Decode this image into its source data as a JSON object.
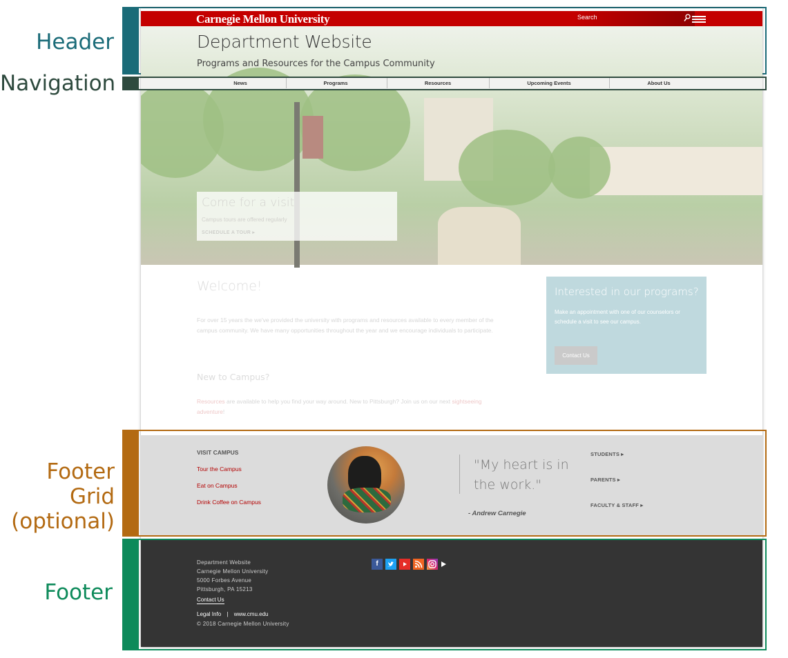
{
  "annotations": {
    "header": "Header",
    "navigation": "Navigation",
    "footer_grid": [
      "Footer Grid",
      "(optional)"
    ],
    "footer": "Footer"
  },
  "colors": {
    "header_annotation": "#1a6b78",
    "navigation_annotation": "#2e4a3e",
    "footer_grid_annotation": "#b36a12",
    "footer_annotation": "#0d8a5a",
    "brand_red": "#c40000"
  },
  "header": {
    "brand": "Carnegie Mellon University",
    "search_label": "Search",
    "search_icon": "search-icon",
    "menu_icon": "hamburger-menu-icon",
    "title": "Department Website",
    "subtitle": "Programs and Resources for the Campus Community"
  },
  "nav": {
    "items": [
      "News",
      "Programs",
      "Resources",
      "Upcoming Events",
      "About Us"
    ]
  },
  "hero": {
    "heading": "Come for a visit",
    "text": "Campus tours are offered regularly",
    "link": "SCHEDULE A TOUR ▸"
  },
  "main": {
    "welcome_heading": "Welcome!",
    "welcome_text": "For over 15 years the we've provided the university with programs and resources available to every member of the campus community. We have many opportunities throughout the year and we encourage individuals to participate.",
    "new_heading": "New to Campus?",
    "new_link1": "Resources",
    "new_text1": " are available to help you find your way around. New to Pittsburgh? Join us on our next ",
    "new_link2": "sightseeing adventure",
    "new_text2": "!"
  },
  "promo": {
    "heading": "Interested in our programs?",
    "text": "Make an appointment with one of our counselors or schedule a visit to see our campus.",
    "button": "Contact Us"
  },
  "footer_grid": {
    "heading": "VISIT CAMPUS",
    "links": [
      "Tour the Campus",
      "Eat on Campus",
      "Drink Coffee on Campus"
    ],
    "quote": "\"My heart is in the work.\"",
    "attribution": "- Andrew Carnegie",
    "audiences": [
      "STUDENTS ▸",
      "PARENTS ▸",
      "FACULTY & STAFF ▸"
    ]
  },
  "footer": {
    "address": [
      "Department Website",
      "Carnegie Mellon University",
      "5000 Forbes Avenue",
      "Pittsburgh, PA 15213"
    ],
    "contact": "Contact Us",
    "legal": "Legal Info",
    "separator": "|",
    "website": "www.cmu.edu",
    "copyright": "© 2018 Carnegie Mellon University",
    "social_icons": [
      "facebook-icon",
      "twitter-icon",
      "youtube-icon",
      "rss-icon",
      "instagram-icon",
      "play-icon"
    ]
  }
}
